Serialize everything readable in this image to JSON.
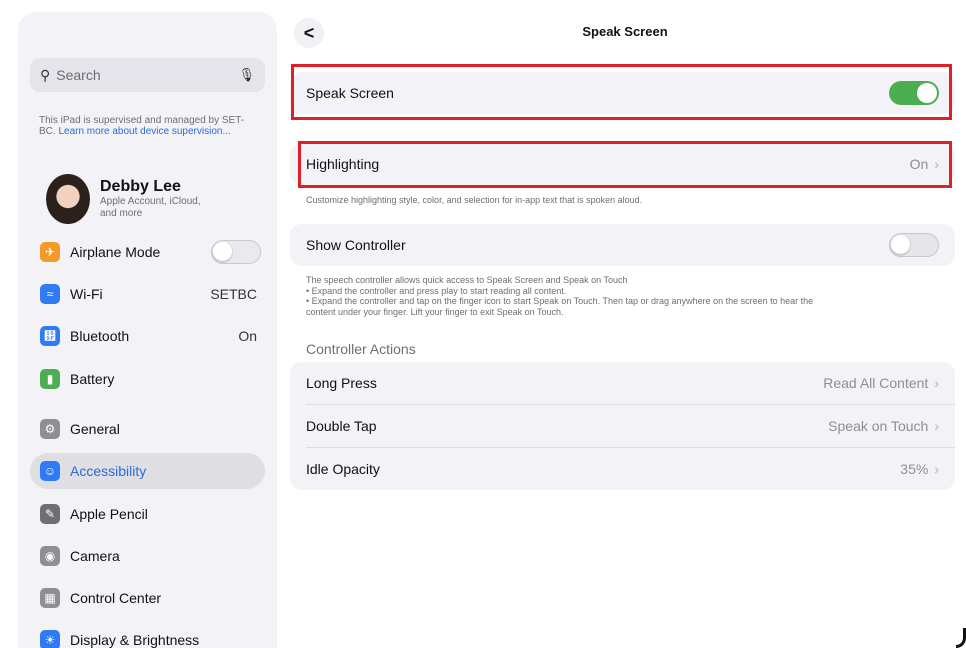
{
  "sidebar": {
    "search_placeholder": "Search",
    "supervised_text": "This iPad is supervised and managed by SET-BC.",
    "supervised_link": "Learn more about device supervision...",
    "profile": {
      "name": "Debby Lee",
      "subtitle": "Apple Account, iCloud, and more"
    },
    "items": [
      {
        "label": "Airplane Mode",
        "icon": "airplane-icon",
        "color": "#f39a2b"
      },
      {
        "label": "Wi-Fi",
        "value": "SETBC",
        "icon": "wifi-icon",
        "color": "#2f7bf6"
      },
      {
        "label": "Bluetooth",
        "value": "On",
        "icon": "bluetooth-icon",
        "color": "#2f7bf6"
      },
      {
        "label": "Battery",
        "icon": "battery-icon",
        "color": "#4cae50"
      },
      {
        "label": "General",
        "icon": "gear-icon",
        "color": "#8e8e93"
      },
      {
        "label": "Accessibility",
        "icon": "accessibility-icon",
        "color": "#2f7bf6"
      },
      {
        "label": "Apple Pencil",
        "icon": "pencil-icon",
        "color": "#6e6e73"
      },
      {
        "label": "Camera",
        "icon": "camera-icon",
        "color": "#8e8e93"
      },
      {
        "label": "Control Center",
        "icon": "control-center-icon",
        "color": "#8e8e93"
      },
      {
        "label": "Display & Brightness",
        "icon": "sun-icon",
        "color": "#2f7bf6"
      }
    ]
  },
  "header": {
    "title": "Speak Screen",
    "back": "<"
  },
  "main": {
    "speak_screen": {
      "label": "Speak Screen",
      "toggle": "on"
    },
    "highlighting": {
      "label": "Highlighting",
      "value": "On"
    },
    "highlighting_note": "Customize highlighting style, color, and selection for in-app text that is spoken aloud.",
    "show_controller": {
      "label": "Show Controller",
      "toggle": "off"
    },
    "controller_note": [
      "The speech controller allows quick access to Speak Screen and Speak on Touch",
      " • Expand the controller and press play to start reading all content.",
      " • Expand the controller and tap on the finger icon to start Speak on Touch. Then tap or drag anywhere on the screen to hear the",
      "content under your finger. Lift your finger to exit Speak on Touch."
    ],
    "controller_actions_header": "Controller Actions",
    "actions": [
      {
        "label": "Long Press",
        "value": "Read All Content"
      },
      {
        "label": "Double Tap",
        "value": "Speak on Touch"
      },
      {
        "label": "Idle Opacity",
        "value": "35%"
      }
    ]
  }
}
